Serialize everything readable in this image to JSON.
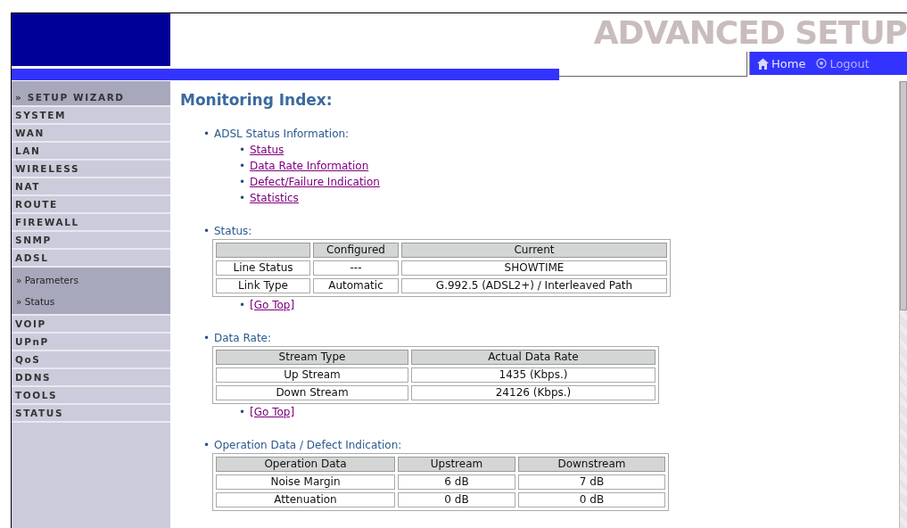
{
  "header": {
    "title": "ADVANCED SETUP",
    "nav": [
      {
        "kind": "home",
        "label": "Home"
      },
      {
        "kind": "logout",
        "label": "Logout"
      }
    ]
  },
  "sidebar": {
    "items": [
      {
        "label": "» SETUP WIZARD",
        "kind": "wizard"
      },
      {
        "label": "SYSTEM",
        "kind": "menu"
      },
      {
        "label": "WAN",
        "kind": "menu"
      },
      {
        "label": "LAN",
        "kind": "menu"
      },
      {
        "label": "WIRELESS",
        "kind": "menu"
      },
      {
        "label": "NAT",
        "kind": "menu"
      },
      {
        "label": "ROUTE",
        "kind": "menu"
      },
      {
        "label": "FIREWALL",
        "kind": "menu"
      },
      {
        "label": "SNMP",
        "kind": "menu"
      },
      {
        "label": "ADSL",
        "kind": "menu",
        "expanded": true,
        "children": [
          {
            "label": "» Parameters"
          },
          {
            "label": "» Status"
          }
        ]
      },
      {
        "label": "VOIP",
        "kind": "menu"
      },
      {
        "label": "UPnP",
        "kind": "menu"
      },
      {
        "label": "QoS",
        "kind": "menu"
      },
      {
        "label": "DDNS",
        "kind": "menu"
      },
      {
        "label": "TOOLS",
        "kind": "menu"
      },
      {
        "label": "STATUS",
        "kind": "menu"
      }
    ]
  },
  "content": {
    "heading": "Monitoring Index:",
    "index": {
      "bullet": "•",
      "label": "ADSL Status Information:",
      "links": [
        {
          "bullet": "•",
          "label": "Status"
        },
        {
          "bullet": "•",
          "label": "Data Rate Information"
        },
        {
          "bullet": "•",
          "label": "Defect/Failure Indication"
        },
        {
          "bullet": "•",
          "label": "Statistics"
        }
      ]
    },
    "sections": [
      {
        "bullet": "•",
        "label": "Status:",
        "go_top": {
          "bullet": "•",
          "label": "[Go Top]"
        },
        "columns": [
          "",
          "Configured",
          "Current"
        ],
        "rows": [
          [
            "Line Status",
            "---",
            "SHOWTIME"
          ],
          [
            "Link Type",
            "Automatic",
            "G.992.5 (ADSL2+) / Interleaved Path"
          ]
        ]
      },
      {
        "bullet": "•",
        "label": "Data Rate:",
        "go_top": {
          "bullet": "•",
          "label": "[Go Top]"
        },
        "columns": [
          "Stream Type",
          "Actual Data Rate"
        ],
        "rows": [
          [
            "Up Stream",
            "1435 (Kbps.)"
          ],
          [
            "Down Stream",
            "24126 (Kbps.)"
          ]
        ]
      },
      {
        "bullet": "•",
        "label": "Operation Data / Defect Indication:",
        "columns": [
          "Operation Data",
          "Upstream",
          "Downstream"
        ],
        "rows": [
          [
            "Noise Margin",
            "6 dB",
            "7 dB"
          ],
          [
            "Attenuation",
            "0 dB",
            "0 dB"
          ]
        ]
      }
    ]
  }
}
